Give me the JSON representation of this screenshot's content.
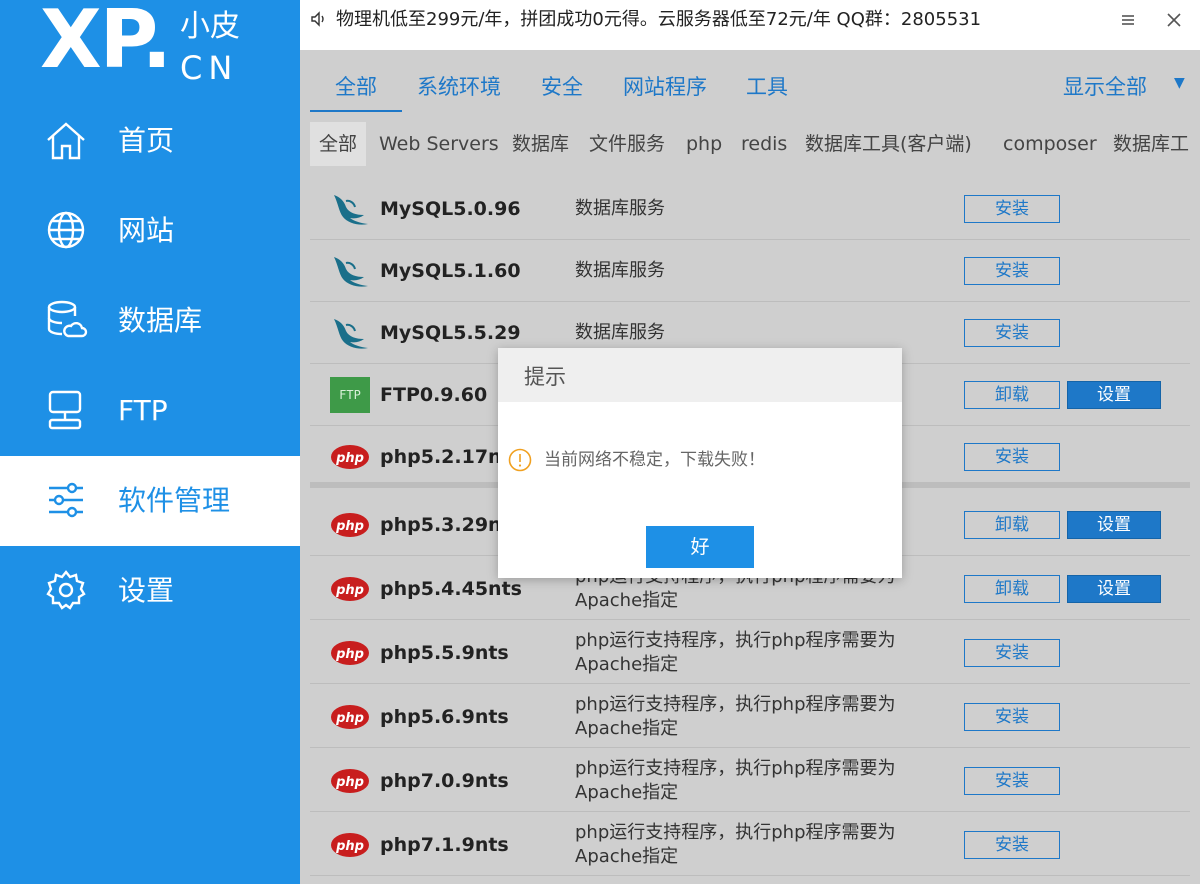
{
  "logo": {
    "main": "XP.",
    "cn_top": "小皮",
    "cn_bottom": "CN"
  },
  "nav": [
    {
      "label": "首页",
      "icon": "home-icon"
    },
    {
      "label": "网站",
      "icon": "globe-icon"
    },
    {
      "label": "数据库",
      "icon": "database-icon"
    },
    {
      "label": "FTP",
      "icon": "server-icon"
    },
    {
      "label": "软件管理",
      "icon": "sliders-icon",
      "active": true
    },
    {
      "label": "设置",
      "icon": "gear-icon"
    }
  ],
  "notice": "物理机低至299元/年，拼团成功0元得。云服务器低至72元/年  QQ群：2805531",
  "primary_tabs": [
    "全部",
    "系统环境",
    "安全",
    "网站程序",
    "工具"
  ],
  "show_all": "显示全部",
  "secondary_tabs": [
    "全部",
    "Web Servers",
    "数据库",
    "文件服务",
    "php",
    "redis",
    "数据库工具(客户端)",
    "composer",
    "数据库工"
  ],
  "software": [
    {
      "name": "MySQL5.0.96",
      "desc": "数据库服务",
      "icon": "mysql-icon",
      "actions": [
        "安装"
      ]
    },
    {
      "name": "MySQL5.1.60",
      "desc": "数据库服务",
      "icon": "mysql-icon",
      "actions": [
        "安装"
      ]
    },
    {
      "name": "MySQL5.5.29",
      "desc": "数据库服务",
      "icon": "mysql-icon",
      "actions": [
        "安装"
      ]
    },
    {
      "name": "FTP0.9.60",
      "desc": "",
      "icon": "ftp-icon",
      "icon_text": "FTP",
      "actions": [
        "卸载",
        "设置"
      ]
    },
    {
      "name": "php5.2.17nts",
      "desc": "",
      "icon": "php-icon",
      "actions": [
        "安装"
      ]
    },
    {
      "name": "php5.3.29nts",
      "desc": "",
      "icon": "php-icon",
      "actions": [
        "卸载",
        "设置"
      ]
    },
    {
      "name": "php5.4.45nts",
      "desc": "php运行支持程序，执行php程序需要为Apache指定",
      "icon": "php-icon",
      "actions": [
        "卸载",
        "设置"
      ]
    },
    {
      "name": "php5.5.9nts",
      "desc": "php运行支持程序，执行php程序需要为Apache指定",
      "icon": "php-icon",
      "actions": [
        "安装"
      ]
    },
    {
      "name": "php5.6.9nts",
      "desc": "php运行支持程序，执行php程序需要为Apache指定",
      "icon": "php-icon",
      "actions": [
        "安装"
      ]
    },
    {
      "name": "php7.0.9nts",
      "desc": "php运行支持程序，执行php程序需要为Apache指定",
      "icon": "php-icon",
      "actions": [
        "安装"
      ]
    },
    {
      "name": "php7.1.9nts",
      "desc": "php运行支持程序，执行php程序需要为Apache指定",
      "icon": "php-icon",
      "actions": [
        "安装"
      ]
    }
  ],
  "php_badge": "php",
  "dialog": {
    "title": "提示",
    "message": "当前网络不稳定，下载失败！",
    "ok": "好"
  },
  "colors": {
    "sidebar": "#1e90e6",
    "accent": "#1e78c8",
    "overlay": "#cfcfcf"
  }
}
